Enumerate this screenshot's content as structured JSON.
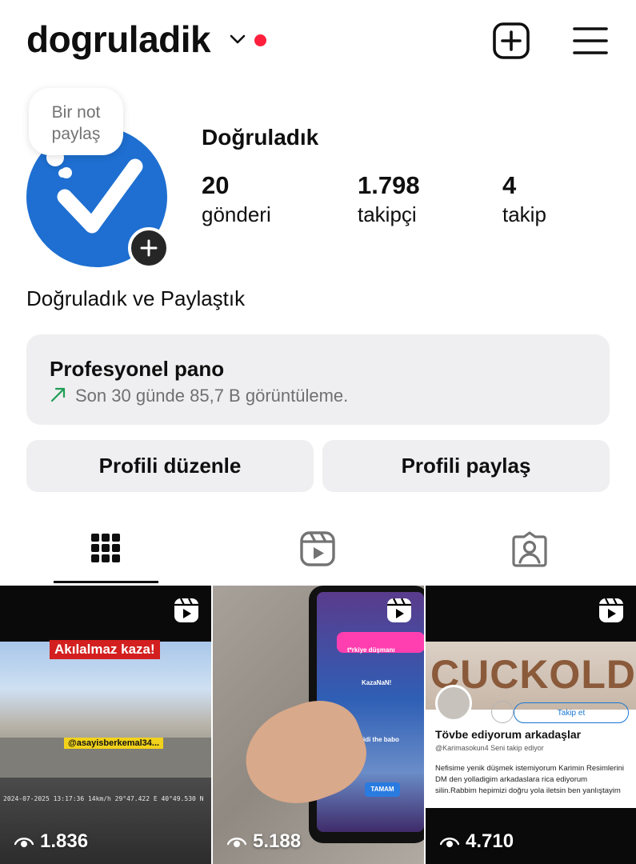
{
  "header": {
    "username": "dogruladik",
    "chevron_icon": "chevron-down-icon",
    "notification_color": "#ff1f3d",
    "add_icon": "add-square-icon",
    "menu_icon": "hamburger-menu-icon"
  },
  "profile": {
    "note_text": "Bir not paylaş",
    "display_name": "Doğruladık",
    "bio": "Doğruladık ve Paylaştık",
    "avatar_color": "#1e6fd1",
    "stats": {
      "posts": {
        "value": "20",
        "label": "gönderi"
      },
      "followers": {
        "value": "1.798",
        "label": "takipçi"
      },
      "following": {
        "value": "4",
        "label": "takip"
      }
    }
  },
  "dashboard": {
    "title": "Profesyonel pano",
    "subtitle": "Son 30 günde 85,7 B görüntüleme."
  },
  "buttons": {
    "edit": "Profili düzenle",
    "share": "Profili paylaş"
  },
  "tabs": [
    {
      "name": "grid",
      "icon": "grid-icon",
      "active": true
    },
    {
      "name": "reels",
      "icon": "reels-icon",
      "active": false
    },
    {
      "name": "tagged",
      "icon": "tagged-person-icon",
      "active": false
    }
  ],
  "posts": [
    {
      "views": "1.836",
      "overlay_title": "Akılalmaz kaza!",
      "overlay_handle": "@asayisberkemal34...",
      "timestamp": "2024-07-2025 13:17:36 14km/h 29°47.422 E 40°49.530 N"
    },
    {
      "views": "5.188",
      "game_text_1": "t*rkiye düşmanı",
      "game_text_2": "KazaNaN!",
      "game_text_3": "ümidi the babo",
      "game_button": "TAMAM"
    },
    {
      "views": "4.710",
      "banner_word": "CUCKOLD",
      "follow_label": "Takip et",
      "post_title": "Tövbe ediyorum arkadaşlar",
      "post_handle": "@Karimasokun4  Seni takip ediyor",
      "post_body": "Nefisime yenik düşmek istemiyorum Karimin Resimlerini DM den yolladigim arkadaslara rica ediyorum silin.Rabbim hepimizi doğru yola iletsin ben yanlıştayim"
    }
  ]
}
